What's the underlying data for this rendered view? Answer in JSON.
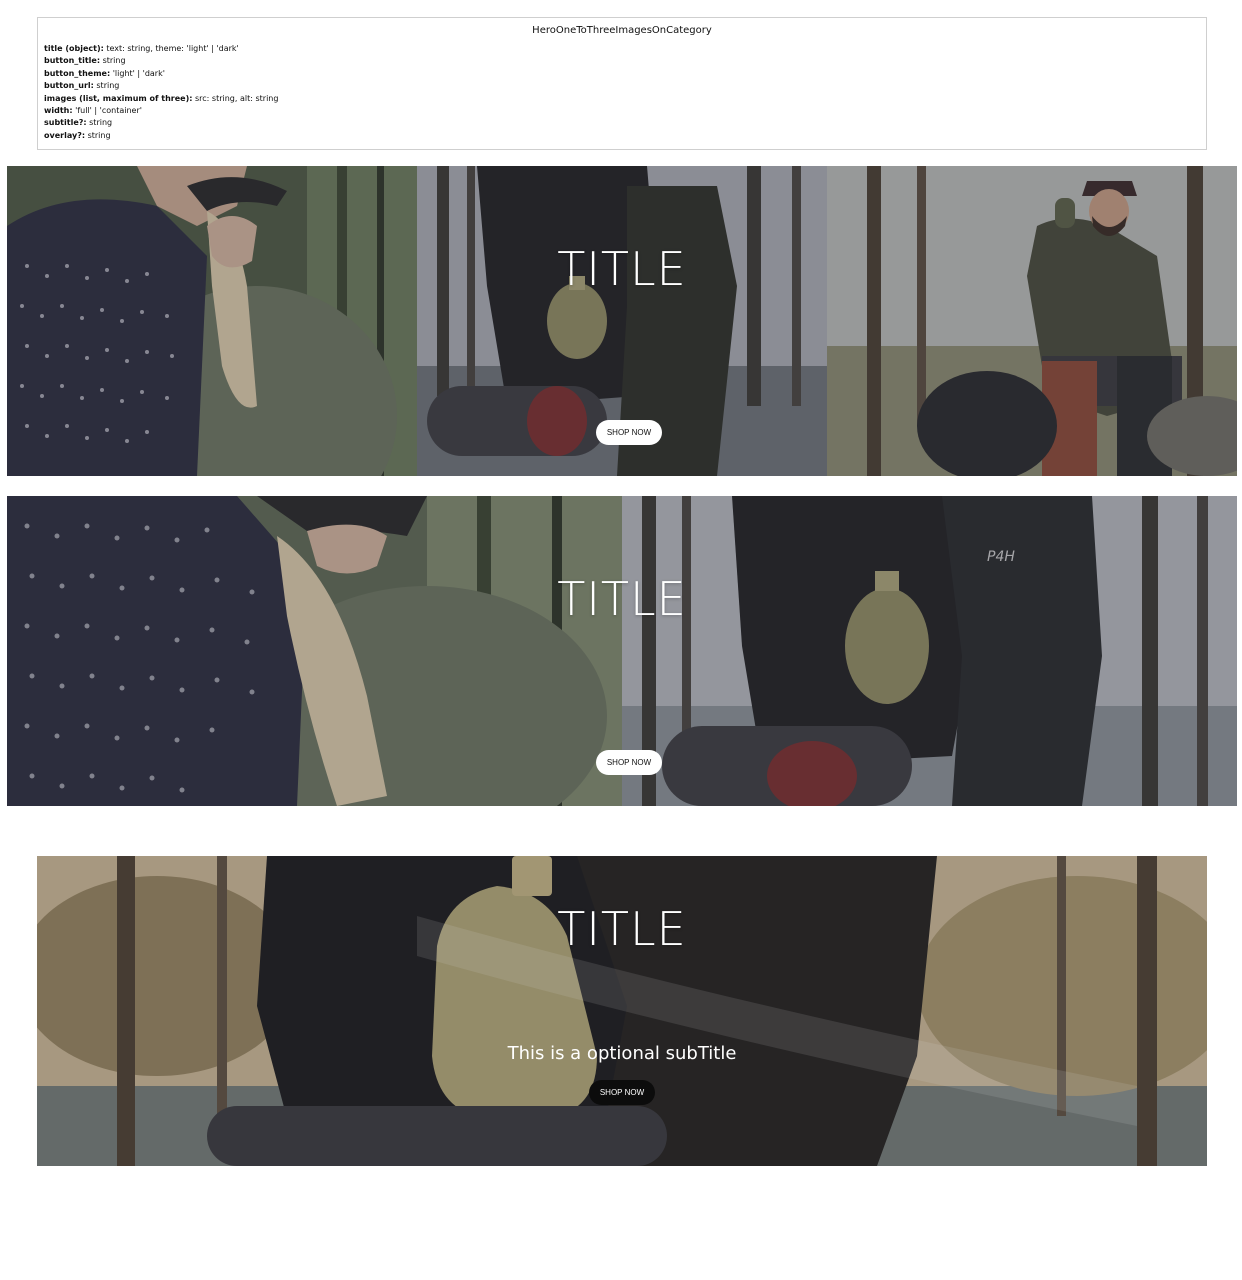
{
  "spec": {
    "component_name": "HeroOneToThreeImagesOnCategory",
    "props": [
      {
        "key": "title (object):",
        "value": "text: string, theme: 'light' | 'dark'"
      },
      {
        "key": "button_title:",
        "value": "string"
      },
      {
        "key": "button_theme:",
        "value": "'light' | 'dark'"
      },
      {
        "key": "button_url:",
        "value": "string"
      },
      {
        "key": "images (list, maximum of three):",
        "value": "src: string, alt: string"
      },
      {
        "key": "width:",
        "value": "'full' | 'container'"
      },
      {
        "key": "subtitle?:",
        "value": "string"
      },
      {
        "key": "overlay?:",
        "value": "string"
      }
    ]
  },
  "heroes": [
    {
      "title": "TITLE",
      "button_label": "SHOP NOW",
      "button_theme": "light",
      "width": "full",
      "image_count": 3
    },
    {
      "title": "TITLE",
      "button_label": "SHOP NOW",
      "button_theme": "light",
      "width": "full",
      "image_count": 2
    },
    {
      "title": "TITLE",
      "subtitle": "This is a optional subTitle",
      "button_label": "SHOP NOW",
      "button_theme": "dark",
      "width": "container",
      "image_count": 1
    }
  ],
  "colors": {
    "overlay": "#282837",
    "button_light": "#ffffff",
    "button_dark": "#0c0c0c",
    "title_text": "#ffffff"
  }
}
